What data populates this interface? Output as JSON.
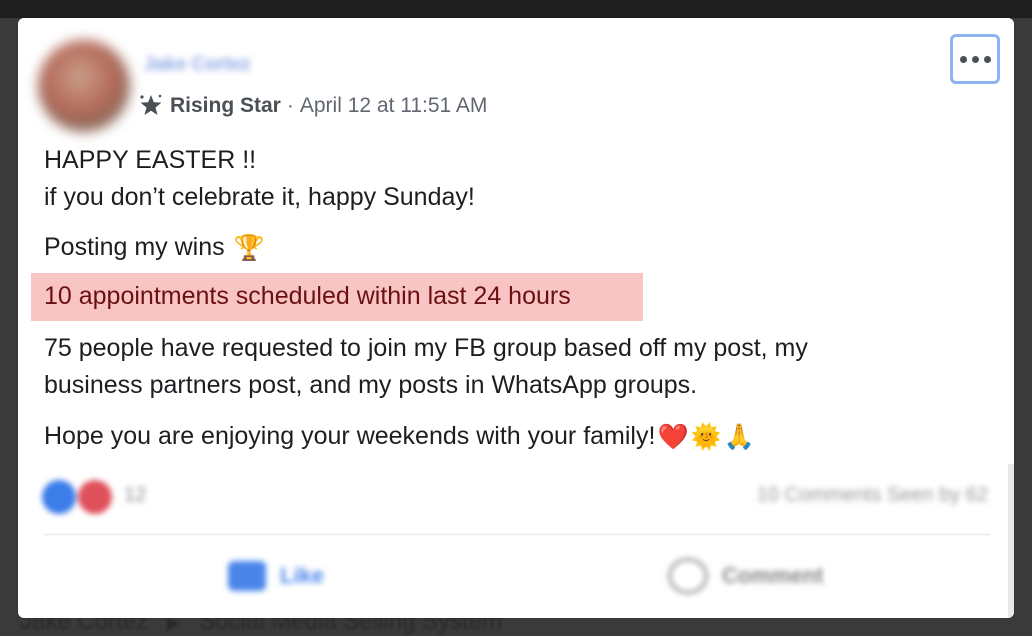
{
  "background": {
    "breadcrumb_author": "Jake Cortez",
    "breadcrumb_separator": "▶",
    "breadcrumb_group": "Social Media Selling System"
  },
  "post": {
    "author_name": "Jake Cortez",
    "badge": "Rising Star",
    "separator": "·",
    "timestamp": "April 12 at 11:51 AM",
    "lines": {
      "l1": "HAPPY EASTER !!",
      "l2": "if you don’t celebrate it, happy Sunday!",
      "l3": "Posting my wins",
      "l4": "10 appointments scheduled within last 24 hours",
      "l5": "75 people have requested to join my FB group based off my post, my",
      "l6": "business partners post, and my posts in WhatsApp groups.",
      "l7": "Hope you are enjoying your weekends with your family!"
    },
    "emojis": {
      "trophy": "🏆",
      "heart": "❤️",
      "sun": "🌞",
      "pray": "🙏"
    },
    "highlight_color": "#f9c4c4",
    "reactions": {
      "count": "12",
      "comments_seen": "10 Comments  Seen by 62"
    },
    "actions": {
      "like": "Like",
      "comment": "Comment"
    }
  },
  "colors": {
    "link_blue": "#4a86ea",
    "meta_gray": "#616770",
    "text": "#1c1e21"
  }
}
